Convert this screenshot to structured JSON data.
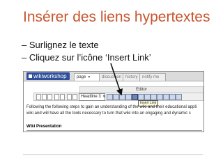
{
  "slide": {
    "title": "Insérer des liens hypertextes",
    "bullets": [
      "– Surlignez le texte",
      "– Cliquez sur l’icône ‘Insert Link’"
    ]
  },
  "screenshot": {
    "brand": "wikiworkshop",
    "tabs": {
      "page": "page",
      "discussion": "discussion",
      "history": "history",
      "notify": "notify me"
    },
    "editor_label": "Editor",
    "heading_select_value": "Headline 3",
    "tooltip": "Insert Link",
    "body_lines": [
      "Following the following steps to gain an understanding of the wiki and their educational appli",
      "wiki and will have all the tools necessary to turn that wiki into an engaging and dynamic s"
    ],
    "wiki_heading": "Wiki Presentation"
  },
  "colors": {
    "title": "#c8542c",
    "arrow": "#111111"
  }
}
